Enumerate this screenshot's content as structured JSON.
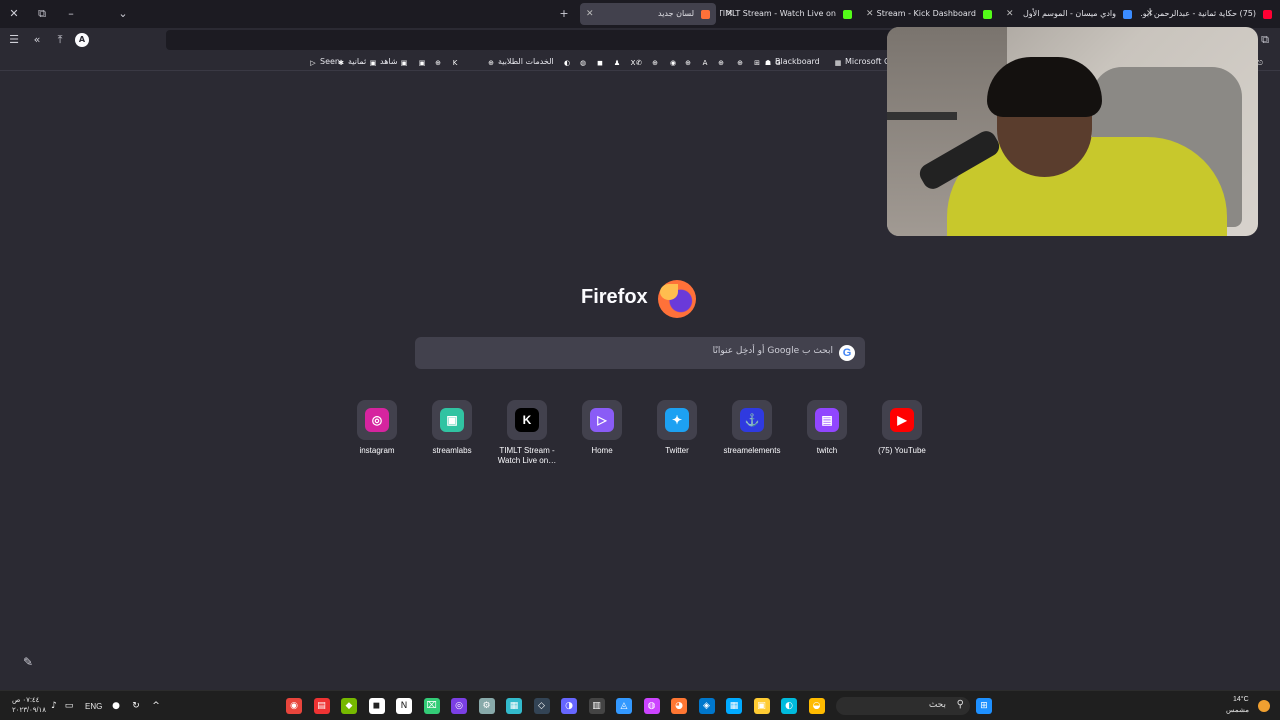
{
  "tabs": [
    {
      "title": "(75) حكاية ثمانية - عبدالرحمن أبو…",
      "favicon_color": "#ff0033"
    },
    {
      "title": "وادي ميسان - الموسم الأول",
      "favicon_color": "#3b8cff"
    },
    {
      "title": "Stream - Kick Dashboard",
      "favicon_color": "#53fc18"
    },
    {
      "title": "TIMLT Stream - Watch Live on",
      "favicon_color": "#53fc18"
    },
    {
      "title": "لسان جديد",
      "favicon_color": "#ff7139"
    }
  ],
  "window_controls": {
    "close": "✕",
    "restore": "⧉",
    "minimize": "–",
    "list_tabs": "⌄",
    "new_tab": "+"
  },
  "navbar": {
    "sidebar": "☰",
    "back": "«",
    "extensions": "⤒",
    "account": "A",
    "url_value": "",
    "forward": "→",
    "reader": "⧉"
  },
  "bookmarks": [
    {
      "label": "",
      "icon": "⎋"
    },
    {
      "label": "Microsoft Offi…",
      "icon": "▦"
    },
    {
      "label": "Blackboard",
      "icon": "☗"
    },
    {
      "label": "",
      "icon": "G"
    },
    {
      "label": "",
      "icon": "⊞"
    },
    {
      "label": "",
      "icon": "⊕"
    },
    {
      "label": "",
      "icon": "⊕"
    },
    {
      "label": "",
      "icon": "A"
    },
    {
      "label": "",
      "icon": "⊕"
    },
    {
      "label": "",
      "icon": "◉"
    },
    {
      "label": "",
      "icon": "⊕"
    },
    {
      "label": "",
      "icon": "✆"
    },
    {
      "label": "",
      "icon": "X"
    },
    {
      "label": "",
      "icon": "♟"
    },
    {
      "label": "",
      "icon": "◼"
    },
    {
      "label": "",
      "icon": "◍"
    },
    {
      "label": "",
      "icon": "◐"
    },
    {
      "label": "الخدمات الطلابية",
      "icon": "⊕"
    },
    {
      "label": "",
      "icon": "K"
    },
    {
      "label": "",
      "icon": "⊕"
    },
    {
      "label": "",
      "icon": "▣"
    },
    {
      "label": "",
      "icon": "▣"
    },
    {
      "label": "شاهد",
      "icon": "▣"
    },
    {
      "label": "ثمانية",
      "icon": "✱"
    },
    {
      "label": "Seen",
      "icon": "▷"
    }
  ],
  "newtab": {
    "brand": "Firefox",
    "search_placeholder": "ابحث ب Google أو أدخِل عنوانًا",
    "google_glyph": "G"
  },
  "tiles": [
    {
      "label": "instagram",
      "glyph": "◎",
      "color": "#d6249f"
    },
    {
      "label": "streamlabs",
      "glyph": "▣",
      "color": "#31c3a2"
    },
    {
      "label": "TIMLT Stream - Watch Live on…",
      "glyph": "K",
      "color": "#000000"
    },
    {
      "label": "Home",
      "glyph": "▷",
      "color": "#8a5cf6"
    },
    {
      "label": "Twitter",
      "glyph": "✦",
      "color": "#1da1f2"
    },
    {
      "label": "streamelements",
      "glyph": "⚓",
      "color": "#2f3ae0"
    },
    {
      "label": "twitch",
      "glyph": "▤",
      "color": "#9146ff"
    },
    {
      "label": "(75) YouTube",
      "glyph": "▶",
      "color": "#ff0000"
    }
  ],
  "pencil": "✎",
  "taskbar": {
    "time": "٠٧:٤٤ ص",
    "date": "٢٠٢٣/٠٩/١٨",
    "lang": "ENG",
    "search_label": "بحث",
    "weather_temp": "14°C",
    "weather_text": "مشمس",
    "start": "⊞",
    "icons": [
      "◉",
      "▤",
      "◆",
      "◼",
      "N",
      "⌧",
      "◎",
      "⚙",
      "▦",
      "◇",
      "◑",
      "▥",
      "◬",
      "◍",
      "◕",
      "◈",
      "▦",
      "▣",
      "◐",
      "◒"
    ]
  }
}
